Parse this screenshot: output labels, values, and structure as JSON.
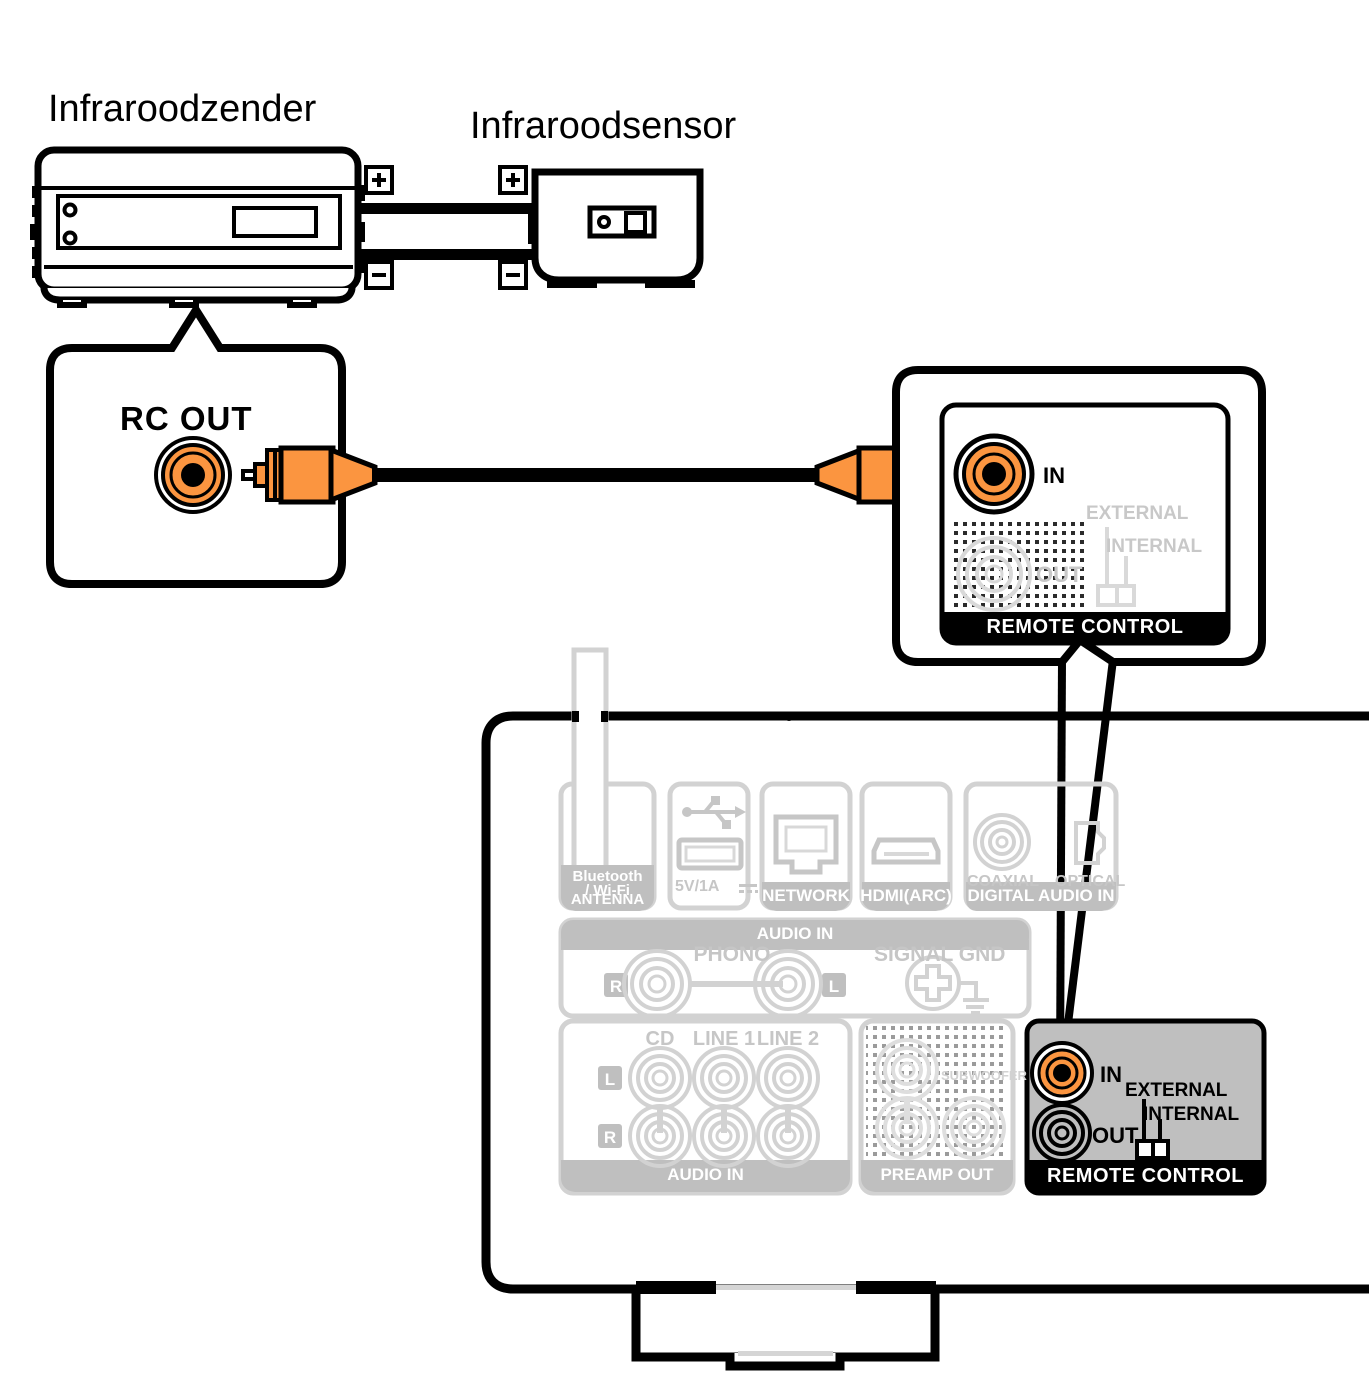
{
  "diagram": {
    "kind": "audio-receiver-remote-control-connection",
    "devices": {
      "ir_transmitter_label": "Infraroodzender",
      "ir_sensor_label": "Infraroodsensor",
      "terminal_plus": "+",
      "terminal_minus": "−"
    },
    "callout_left": {
      "jack_label": "RC OUT"
    },
    "callout_right": {
      "panel_name": "REMOTE CONTROL",
      "jack_in": "IN",
      "jack_out": "OUT",
      "switch_external": "EXTERNAL",
      "switch_internal": "INTERNAL"
    },
    "rear_panel": {
      "antenna": {
        "line1": "Bluetooth",
        "line2": "/ Wi-Fi",
        "line3": "ANTENNA"
      },
      "usb": {
        "spec": "5V/1A"
      },
      "network": {
        "label": "NETWORK"
      },
      "hdmi": {
        "label": "HDMI(ARC)"
      },
      "digital_audio_in": {
        "label": "DIGITAL AUDIO IN",
        "coaxial": "COAXIAL",
        "optical": "OPTICAL"
      },
      "audio_in_phono": {
        "label": "AUDIO IN",
        "phono": "PHONO",
        "signal_gnd": "SIGNAL GND",
        "right": "R",
        "left": "L"
      },
      "audio_in_line": {
        "label": "AUDIO IN",
        "columns": [
          "CD",
          "LINE 1",
          "LINE 2"
        ],
        "left": "L",
        "right": "R"
      },
      "preamp_out": {
        "label": "PREAMP OUT",
        "subwoofer": "SUBWOOFER"
      },
      "remote_control": {
        "panel_name": "REMOTE CONTROL",
        "jack_in": "IN",
        "jack_out": "OUT",
        "switch_external": "EXTERNAL",
        "switch_internal": "INTERNAL"
      }
    },
    "colors": {
      "orange": "#FB9540",
      "orange_dark": "#F08A2E",
      "black": "#000000",
      "panel_gray": "#BFBFBF",
      "faint_gray": "#D8D8D8",
      "mid_gray": "#C6C6C6"
    }
  }
}
